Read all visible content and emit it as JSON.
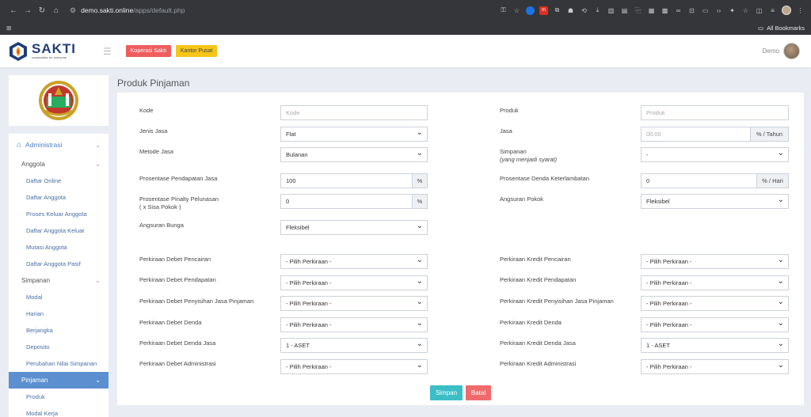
{
  "browser": {
    "url_host": "demo.sakti.online",
    "url_path": "/apps/default.php",
    "bookmarks_label": "All Bookmarks"
  },
  "header": {
    "brand": "SAKTI",
    "tagline": "cooperative for everyone",
    "btn_koperasi": "Koperasi Sakti",
    "btn_kantor": "Kantor Pusat",
    "user_name": "Demo"
  },
  "sidebar": {
    "section": "Administrasi",
    "groups": [
      {
        "label": "Anggota",
        "items": [
          "Daftar Online",
          "Daftar Anggota",
          "Proses Keluar Anggota",
          "Daftar Anggota Keluar",
          "Mutasi Anggota",
          "Daftar Anggota Pasif"
        ]
      },
      {
        "label": "Simpanan",
        "items": [
          "Modal",
          "Harian",
          "Berjangka",
          "Deposito",
          "Perubahan Nilai Simpanan"
        ]
      },
      {
        "label": "Pinjaman",
        "items": [
          "Produk",
          "Modal Kerja"
        ]
      }
    ]
  },
  "page": {
    "title": "Produk Pinjaman"
  },
  "form": {
    "kode_label": "Kode",
    "kode_placeholder": "Kode",
    "produk_label": "Produk",
    "produk_placeholder": "Produk",
    "jenis_jasa_label": "Jenis Jasa",
    "jenis_jasa_value": "Flat",
    "jasa_label": "Jasa",
    "jasa_placeholder": "00.00",
    "jasa_unit": "% / Tahun",
    "metode_jasa_label": "Metode Jasa",
    "metode_jasa_value": "Bulanan",
    "simpanan_label": "Simpanan",
    "simpanan_sub": "(yang menjadi syarat)",
    "simpanan_value": "-",
    "pendapatan_label": "Prosentase Pendapatan Jasa",
    "pendapatan_value": "100",
    "pendapatan_unit": "%",
    "denda_label": "Prosentase Denda Keterlambatan",
    "denda_value": "0",
    "denda_unit": "% / Hari",
    "pinalty_label": "Prosentase Pinalty Pelunasan",
    "pinalty_sub": "( x Sisa Pokok )",
    "pinalty_value": "0",
    "pinalty_unit": "%",
    "angsuran_pokok_label": "Angsuran Pokok",
    "angsuran_pokok_value": "Fleksibel",
    "angsuran_bunga_label": "Angsuran Bunga",
    "angsuran_bunga_value": "Fleksibel",
    "debet": [
      {
        "label": "Perkiraan Debet Pencairan",
        "value": "- Pilih Perkiraan -"
      },
      {
        "label": "Perkiraan Debet Pendapatan",
        "value": "- Pilih Perkiraan -"
      },
      {
        "label": "Perkiraan Debet Penyisihan Jasa Pinjaman",
        "value": "- Pilih Perkiraan -"
      },
      {
        "label": "Perkiraan Debet Denda",
        "value": "- Pilih Perkiraan -"
      },
      {
        "label": "Perkiraan Debet Denda Jasa",
        "value": "1 - ASET"
      },
      {
        "label": "Perkiraan Debet Administrasi",
        "value": "- Pilih Perkiraan -"
      }
    ],
    "kredit": [
      {
        "label": "Perkiraan Kredit Pencairan",
        "value": "- Pilih Perkiraan -"
      },
      {
        "label": "Perkiraan Kredit Pendapatan",
        "value": "- Pilih Perkiraan -"
      },
      {
        "label": "Perkiraan Kredit Penyisihan Jasa Pinjaman",
        "value": "- Pilih Perkiraan -"
      },
      {
        "label": "Perkiraan Kredit Denda",
        "value": "- Pilih Perkiraan -"
      },
      {
        "label": "Perkiraan Kredit Denda Jasa",
        "value": "1 - ASET"
      },
      {
        "label": "Perkiraan Kredit Administrasi",
        "value": "- Pilih Perkiraan -"
      }
    ],
    "save_label": "Simpan",
    "cancel_label": "Batal"
  },
  "colors": {
    "save": "#3bbec6",
    "cancel": "#ef6b6b",
    "sidebar_active": "#5b8fd0",
    "brand": "#1f3d7a"
  }
}
